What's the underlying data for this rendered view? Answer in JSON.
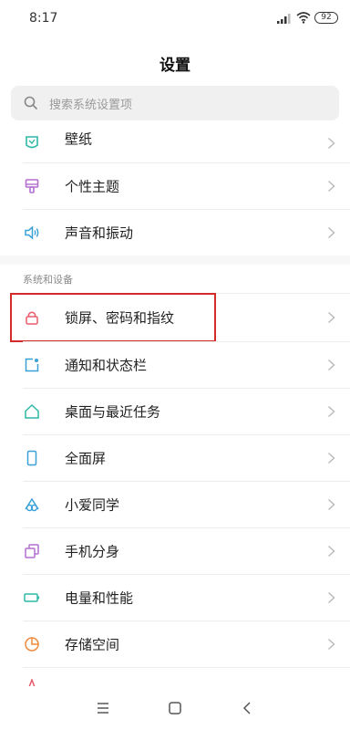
{
  "status_bar": {
    "time": "8:17",
    "battery": "92"
  },
  "header": {
    "title": "设置"
  },
  "search": {
    "placeholder": "搜索系统设置项"
  },
  "groups": {
    "personalization": [
      {
        "label": "壁纸",
        "icon": "wallpaper-icon",
        "color": "#2fb9a6"
      },
      {
        "label": "个性主题",
        "icon": "theme-icon",
        "color": "#b46fd1"
      },
      {
        "label": "声音和振动",
        "icon": "speaker-icon",
        "color": "#3aa0d8"
      }
    ],
    "system_section": {
      "header": "系统和设备",
      "items": [
        {
          "label": "锁屏、密码和指纹",
          "icon": "lock-icon",
          "color": "#e85c6a"
        },
        {
          "label": "通知和状态栏",
          "icon": "notification-icon",
          "color": "#3aa0d8"
        },
        {
          "label": "桌面与最近任务",
          "icon": "home-icon",
          "color": "#2fb9a6"
        },
        {
          "label": "全面屏",
          "icon": "fullscreen-icon",
          "color": "#3aa0d8"
        },
        {
          "label": "小爱同学",
          "icon": "xiaoai-icon",
          "color": "#3aa0d8"
        },
        {
          "label": "手机分身",
          "icon": "dual-phone-icon",
          "color": "#b46fd1"
        },
        {
          "label": "电量和性能",
          "icon": "battery-icon",
          "color": "#2fb9a6"
        },
        {
          "label": "存储空间",
          "icon": "storage-icon",
          "color": "#f08a3c"
        }
      ]
    }
  },
  "nav": {
    "items": [
      "menu-icon",
      "home-square-icon",
      "back-icon"
    ]
  },
  "colors": {
    "highlight": "#d32a2a",
    "divider": "#ececec",
    "search_bg": "#f0f0f0"
  }
}
